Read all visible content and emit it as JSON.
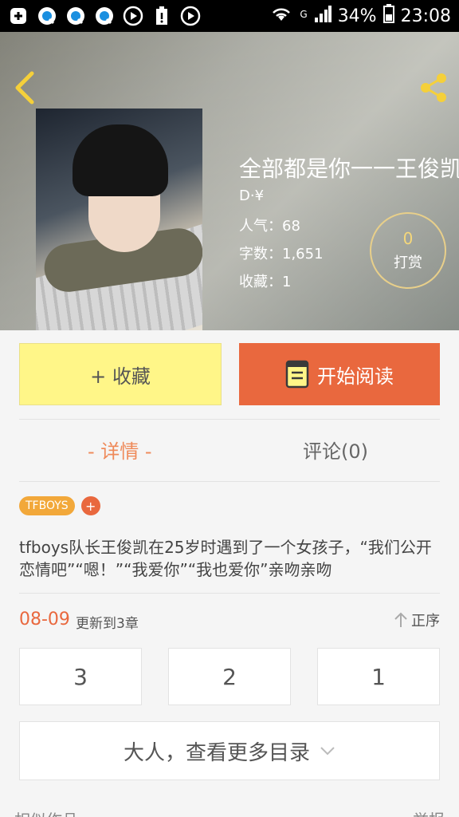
{
  "status_bar": {
    "signal_label": "G",
    "battery": "34%",
    "time": "23:08",
    "icons": [
      "add-icon",
      "qq-icon",
      "qq-icon",
      "qq-icon",
      "play-icon",
      "battery-warning-icon",
      "play-icon"
    ]
  },
  "book": {
    "title": "全部都是你一一王俊凯",
    "author": "D·¥",
    "popularity": "人气：68",
    "words": "字数：1,651",
    "favorites": "收藏：1",
    "tip_count": "0",
    "tip_label": "打赏"
  },
  "actions": {
    "favorite": "+ 收藏",
    "read": "开始阅读"
  },
  "tabs": {
    "details": "- 详情 -",
    "comments": "评论(0)"
  },
  "tags": [
    "TFBOYS"
  ],
  "tag_add": "+",
  "description": "tfboys队长王俊凯在25岁时遇到了一个女孩子，“我们公开恋情吧”“嗯！”“我爱你”“我也爱你”亲吻亲吻",
  "chapters": {
    "date": "08-09",
    "update_text": "更新到3章",
    "sort_label": "正序",
    "items": [
      "3",
      "2",
      "1"
    ],
    "more_label": "大人，查看更多目录"
  },
  "footer": {
    "similar": "相似作品",
    "report": "举报"
  },
  "colors": {
    "accent": "#e9683e",
    "favorite_bg": "#fff688",
    "tag_bg": "#f2a83a",
    "tab_active": "#ef8a5a"
  }
}
